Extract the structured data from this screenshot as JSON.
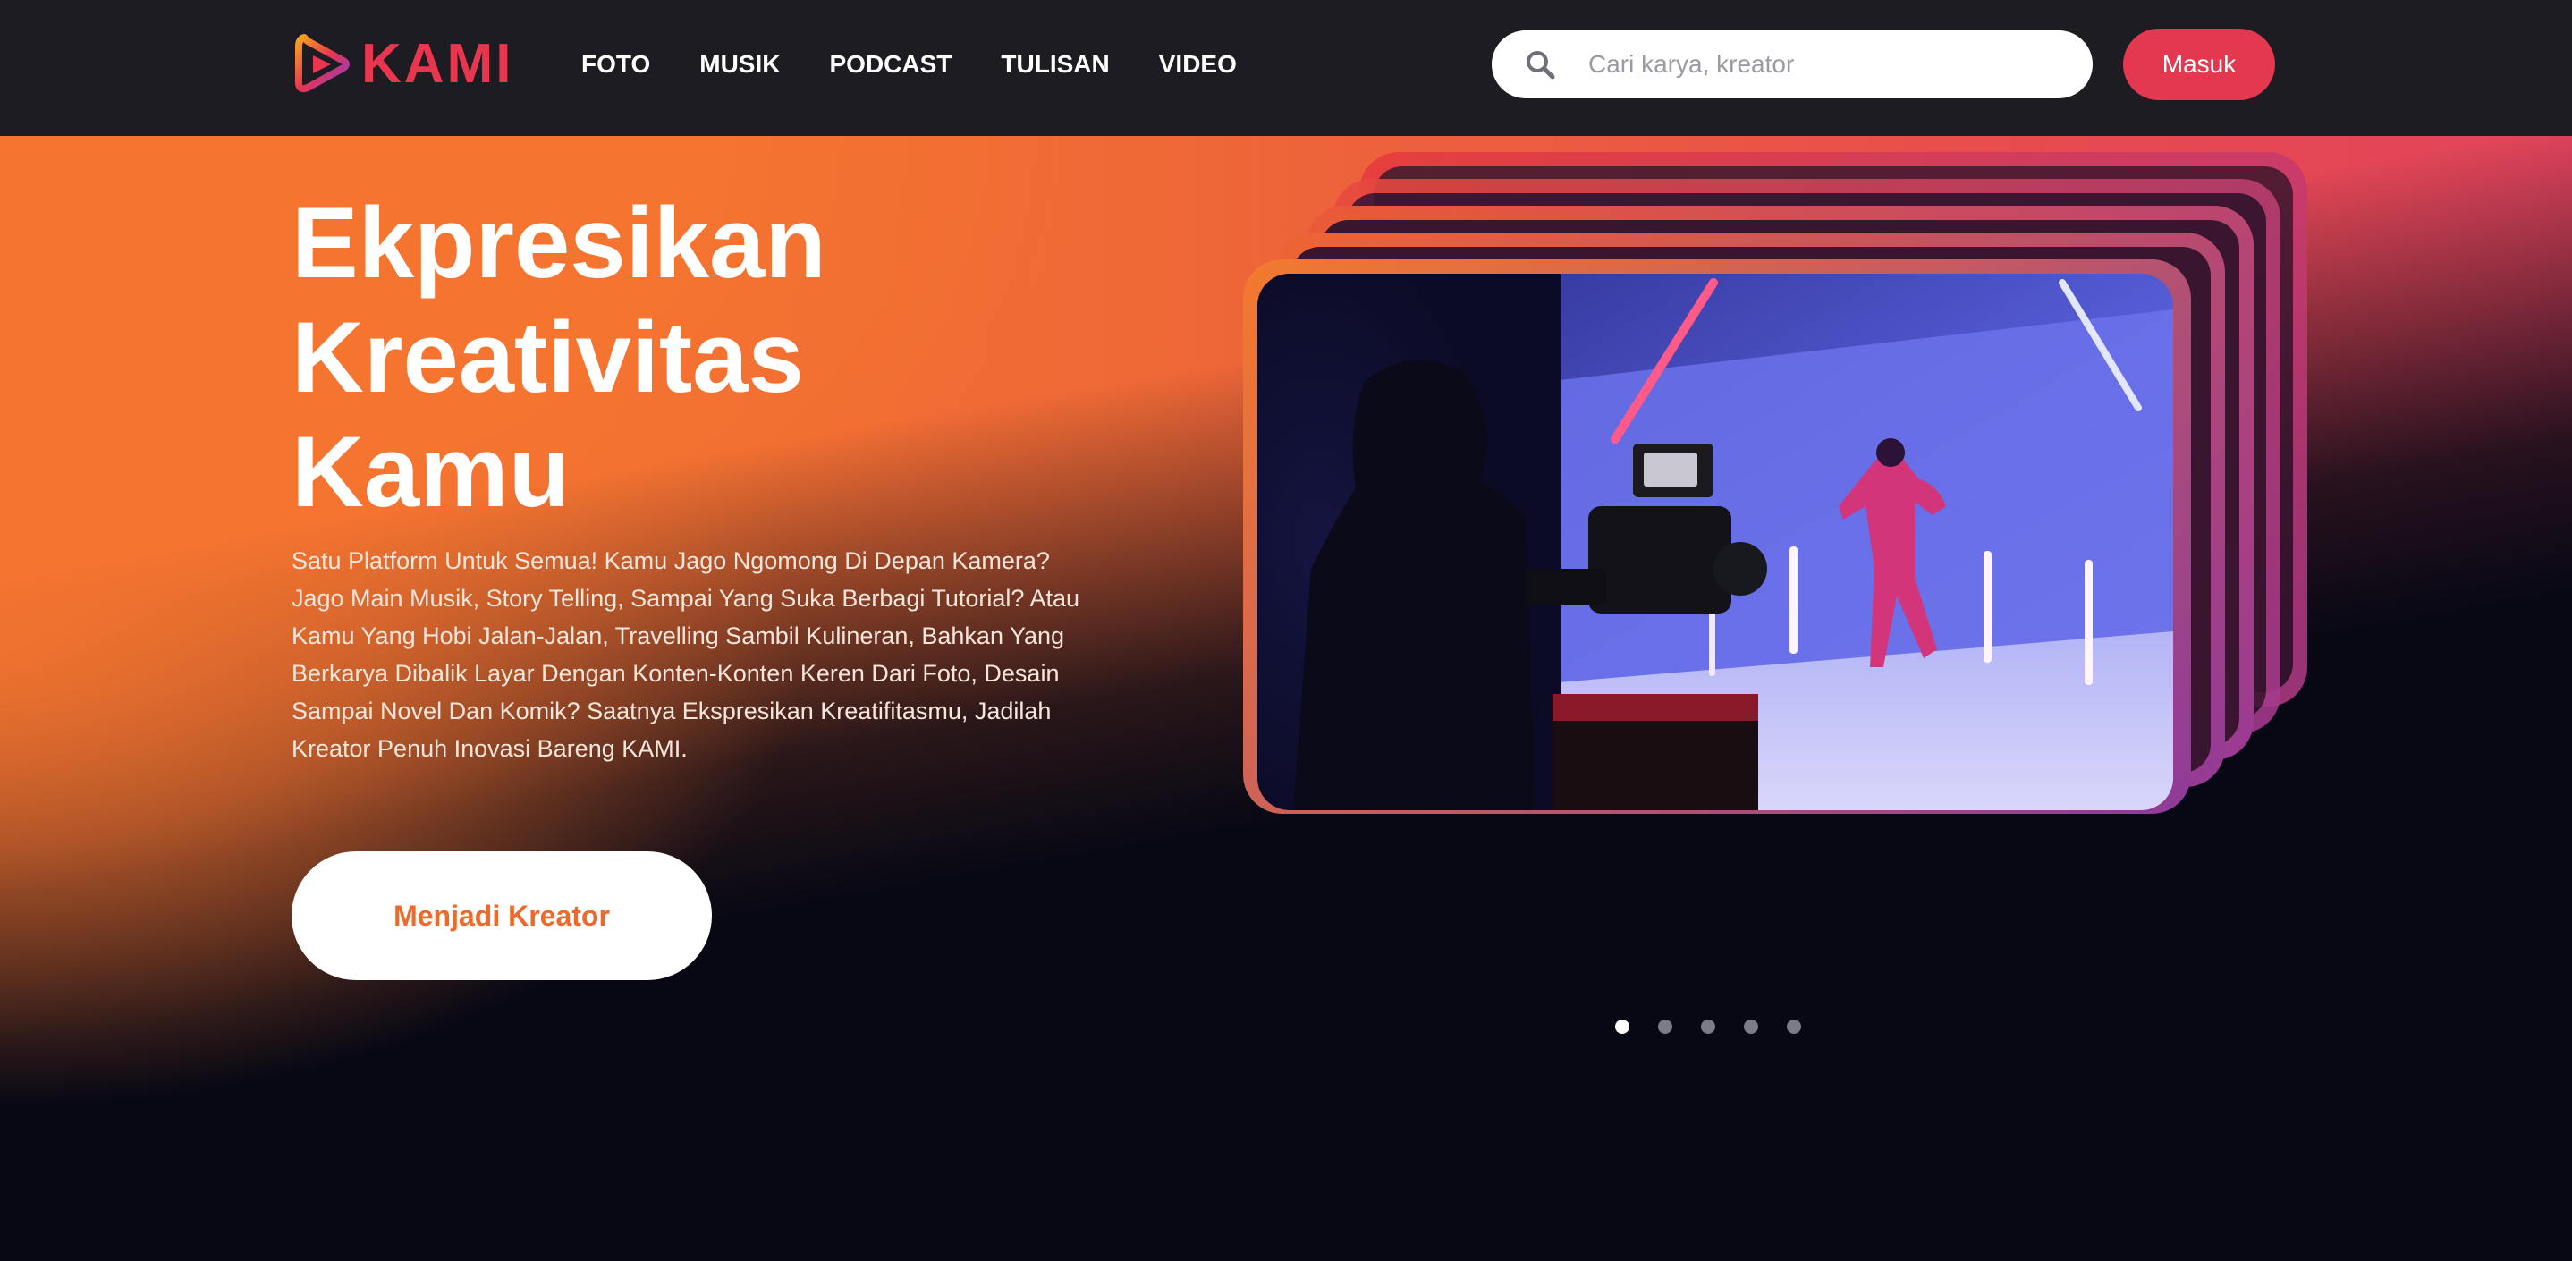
{
  "header": {
    "logo_text": "KAMI",
    "nav": [
      {
        "label": "FOTO"
      },
      {
        "label": "MUSIK"
      },
      {
        "label": "PODCAST"
      },
      {
        "label": "TULISAN"
      },
      {
        "label": "VIDEO"
      }
    ],
    "search": {
      "placeholder": "Cari karya, kreator",
      "icon": "search-icon"
    },
    "login_label": "Masuk"
  },
  "hero": {
    "title_lines": [
      "Ekpresikan",
      "Kreativitas",
      "Kamu"
    ],
    "description": "Satu Platform Untuk Semua! Kamu Jago Ngomong Di Depan Kamera? Jago Main Musik, Story Telling, Sampai Yang Suka Berbagi Tutorial? Atau Kamu Yang Hobi Jalan-Jalan, Travelling Sambil Kulineran, Bahkan Yang Berkarya Dibalik Layar Dengan Konten-Konten Keren Dari Foto, Desain Sampai Novel Dan Komik? Saatnya Ekspresikan Kreatifitasmu, Jadilah Kreator Penuh Inovasi Bareng KAMI.",
    "cta_label": "Menjadi Kreator",
    "carousel": {
      "slide_count": 5,
      "active_index": 0
    }
  },
  "colors": {
    "accent_red": "#e43850",
    "brand_orange": "#f4732f",
    "topbar": "#1c1c22",
    "background": "#070814"
  }
}
